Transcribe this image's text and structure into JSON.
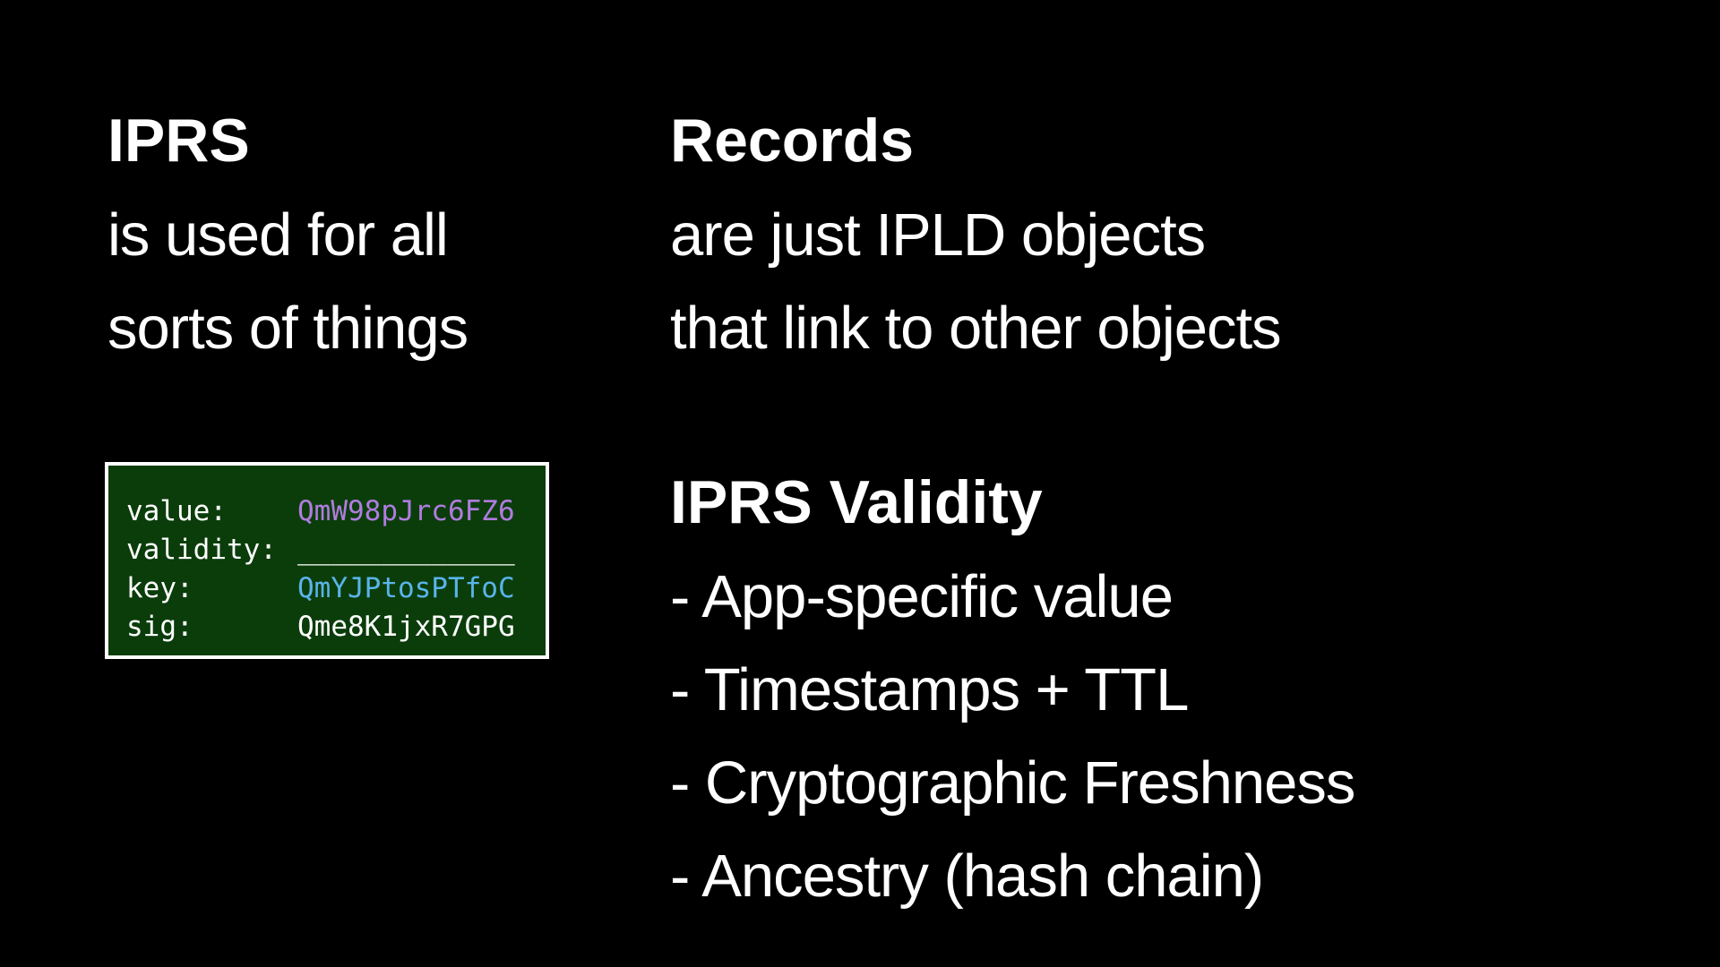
{
  "left": {
    "title": "IPRS",
    "lines": [
      "is used for all",
      "sorts of things"
    ]
  },
  "records": {
    "title": "Records",
    "lines": [
      "are just IPLD objects",
      "that link to other objects"
    ]
  },
  "validity": {
    "title": "IPRS Validity",
    "items": [
      "- App-specific value",
      "- Timestamps + TTL",
      "- Cryptographic Freshness",
      "- Ancestry (hash chain)"
    ]
  },
  "record_box": {
    "rows": [
      {
        "key": "value:",
        "value": "QmW98pJrc6FZ6",
        "color": "#b07ce0"
      },
      {
        "key": "validity:",
        "value": "_____________",
        "color": "#ffffff"
      },
      {
        "key": "key:",
        "value": "QmYJPtosPTfoC",
        "color": "#5ab4ea"
      },
      {
        "key": "sig:",
        "value": "Qme8K1jxR7GPG",
        "color": "#ffffff"
      }
    ]
  },
  "colors": {
    "background": "#000000",
    "text": "#ffffff",
    "box_fill": "#0b3d0b",
    "box_border": "#ffffff"
  }
}
